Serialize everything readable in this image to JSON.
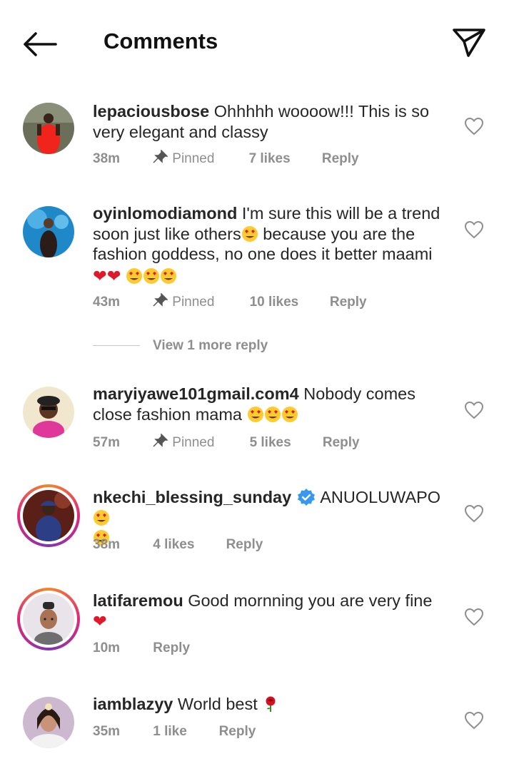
{
  "header": {
    "title": "Comments",
    "back_icon": "arrow-left-icon",
    "share_icon": "paper-plane-icon"
  },
  "comments": [
    {
      "user": "lepaciousbose",
      "text": "Ohhhhh woooow!!! This is so very elegant and classy",
      "time": "38m",
      "pinned": "Pinned",
      "likes": "7 likes",
      "reply": "Reply"
    },
    {
      "user": "oyinlomodiamond",
      "text": "I'm sure this will be a trend soon just like others",
      "text2": " because you are the fashion goddess, no one does it better maami",
      "time": "43m",
      "pinned": "Pinned",
      "likes": "10 likes",
      "reply": "Reply",
      "view_more": "View 1 more reply"
    },
    {
      "user": "maryiyawe101gmail.com4",
      "text": "Nobody comes close fashion mama",
      "time": "57m",
      "pinned": "Pinned",
      "likes": "5 likes",
      "reply": "Reply"
    },
    {
      "user": "nkechi_blessing_sunday",
      "text": "ANUOLUWAPO",
      "time": "38m",
      "likes": "4 likes",
      "reply": "Reply"
    },
    {
      "user": "latifaremou",
      "text": "Good mornning you are very fine",
      "time": "10m",
      "reply": "Reply"
    },
    {
      "user": "iamblazyy",
      "text": "World best",
      "time": "35m",
      "likes": "1 like",
      "reply": "Reply"
    }
  ],
  "colors": {
    "meta_gray": "#8e8e8e",
    "verified_blue": "#3897f0",
    "heart_red": "#e0182b"
  }
}
